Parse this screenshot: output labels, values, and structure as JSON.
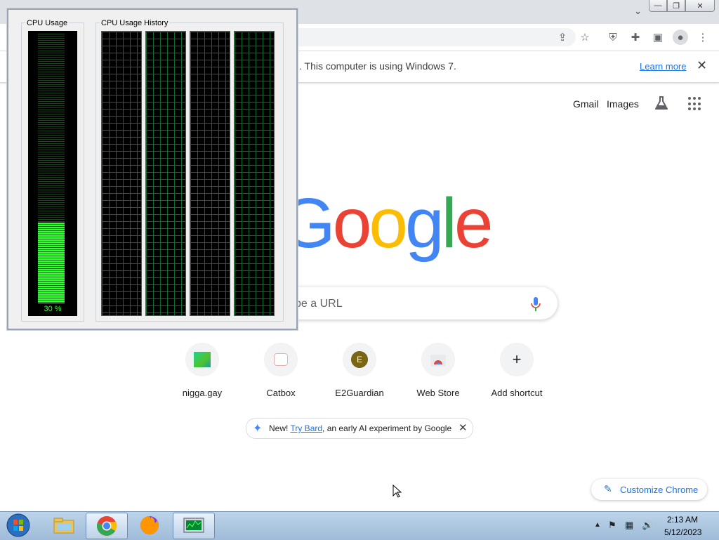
{
  "browser": {
    "infobar": {
      "message": ". This computer is using Windows 7.",
      "learn_more": "Learn more",
      "close_glyph": "✕"
    },
    "window_controls": {
      "minimize": "—",
      "restore": "❐",
      "close": "✕"
    },
    "tab_search_glyph": "⌄"
  },
  "ntp": {
    "header": {
      "gmail": "Gmail",
      "images": "Images"
    },
    "logo_text": "Google",
    "logo_colors": [
      "#4285F4",
      "#EA4335",
      "#FBBC05",
      "#4285F4",
      "#34A853",
      "#EA4335"
    ],
    "search_placeholder": "ype a URL",
    "shortcuts": [
      {
        "label": "nigga.gay",
        "icon": "green-square-favicon"
      },
      {
        "label": "Catbox",
        "icon": "catbox-favicon"
      },
      {
        "label": "E2Guardian",
        "icon": "letter-e-favicon",
        "letter": "E"
      },
      {
        "label": "Web Store",
        "icon": "chrome-web-store-icon"
      },
      {
        "label": "Add shortcut",
        "icon": "plus-icon",
        "glyph": "+"
      }
    ],
    "bard": {
      "prefix": "New! ",
      "link": "Try Bard",
      "suffix": ", an early AI experiment by Google"
    },
    "customize": "Customize Chrome"
  },
  "task_manager": {
    "cpu_usage_label": "CPU Usage",
    "cpu_history_label": "CPU Usage History",
    "cpu_percent": "30 %",
    "cpu_fraction": 0.3,
    "history_panels": 4,
    "meter_color": "#33ff33",
    "grid_color": "#0a6b2d"
  },
  "taskbar": {
    "time": "2:13 AM",
    "date": "5/12/2023",
    "apps": [
      "start-orb",
      "windows-explorer-icon",
      "chrome-icon",
      "firefox-icon",
      "task-manager-icon"
    ]
  }
}
